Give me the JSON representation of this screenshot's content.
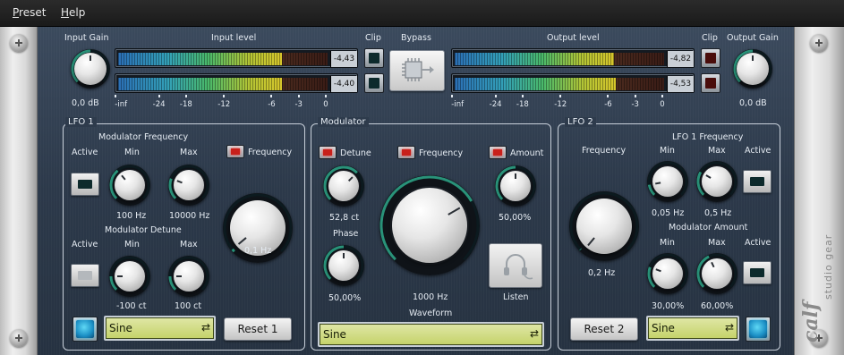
{
  "menu": [
    {
      "accel": "P",
      "rest": "reset"
    },
    {
      "accel": "H",
      "rest": "elp"
    }
  ],
  "top": {
    "input_gain_label": "Input Gain",
    "input_gain_value": "0,0 dB",
    "input_level_label": "Input level",
    "input_meters": [
      {
        "value": "-4,43",
        "fill": 0.78
      },
      {
        "value": "-4,40",
        "fill": 0.78
      }
    ],
    "input_scale": [
      "-inf",
      "-24",
      "-18",
      "-12",
      "-6",
      "-3",
      "0"
    ],
    "clip_label_left": "Clip",
    "bypass_label": "Bypass",
    "output_level_label": "Output level",
    "output_meters": [
      {
        "value": "-4,82",
        "fill": 0.76
      },
      {
        "value": "-4,53",
        "fill": 0.77
      }
    ],
    "output_scale": [
      "-inf",
      "-24",
      "-18",
      "-12",
      "-6",
      "-3",
      "0"
    ],
    "clip_label_right": "Clip",
    "output_gain_label": "Output Gain",
    "output_gain_value": "0,0 dB"
  },
  "lfo1": {
    "title": "LFO 1",
    "mod_freq_label": "Modulator Frequency",
    "active_label_1": "Active",
    "min_label_1": "Min",
    "max_label_1": "Max",
    "frequency_flag_label": "Frequency",
    "min_freq_value": "100 Hz",
    "max_freq_value": "10000 Hz",
    "mod_detune_label": "Modulator Detune",
    "active_label_2": "Active",
    "min_label_2": "Min",
    "max_label_2": "Max",
    "min_detune_value": "-100 ct",
    "max_detune_value": "100 ct",
    "rate_value": "0,1 Hz",
    "waveform": "Sine",
    "reset_label": "Reset 1"
  },
  "modulator": {
    "title": "Modulator",
    "detune_label": "Detune",
    "frequency_label": "Frequency",
    "amount_label": "Amount",
    "detune_value": "52,8 ct",
    "phase_label": "Phase",
    "phase_value": "50,00%",
    "frequency_value": "1000 Hz",
    "amount_value": "50,00%",
    "listen_label": "Listen",
    "waveform_label": "Waveform",
    "waveform": "Sine"
  },
  "lfo2": {
    "title": "LFO 2",
    "frequency_label": "Frequency",
    "lfo1_freq_label": "LFO 1 Frequency",
    "min_label_1": "Min",
    "max_label_1": "Max",
    "active_label_1": "Active",
    "min_freq_value": "0,05 Hz",
    "max_freq_value": "0,5 Hz",
    "mod_amount_label": "Modulator Amount",
    "min_label_2": "Min",
    "max_label_2": "Max",
    "active_label_2": "Active",
    "min_amount_value": "30,00%",
    "max_amount_value": "60,00%",
    "rate_value": "0,2 Hz",
    "reset_label": "Reset 2",
    "waveform": "Sine"
  },
  "brand": {
    "logo": "calf",
    "text": "studio gear"
  },
  "colors": {
    "led_off": "#0d2a2c",
    "led_red": "#c8201b",
    "led_blue": "#1b8fc5",
    "combo": "#cdd97f"
  }
}
